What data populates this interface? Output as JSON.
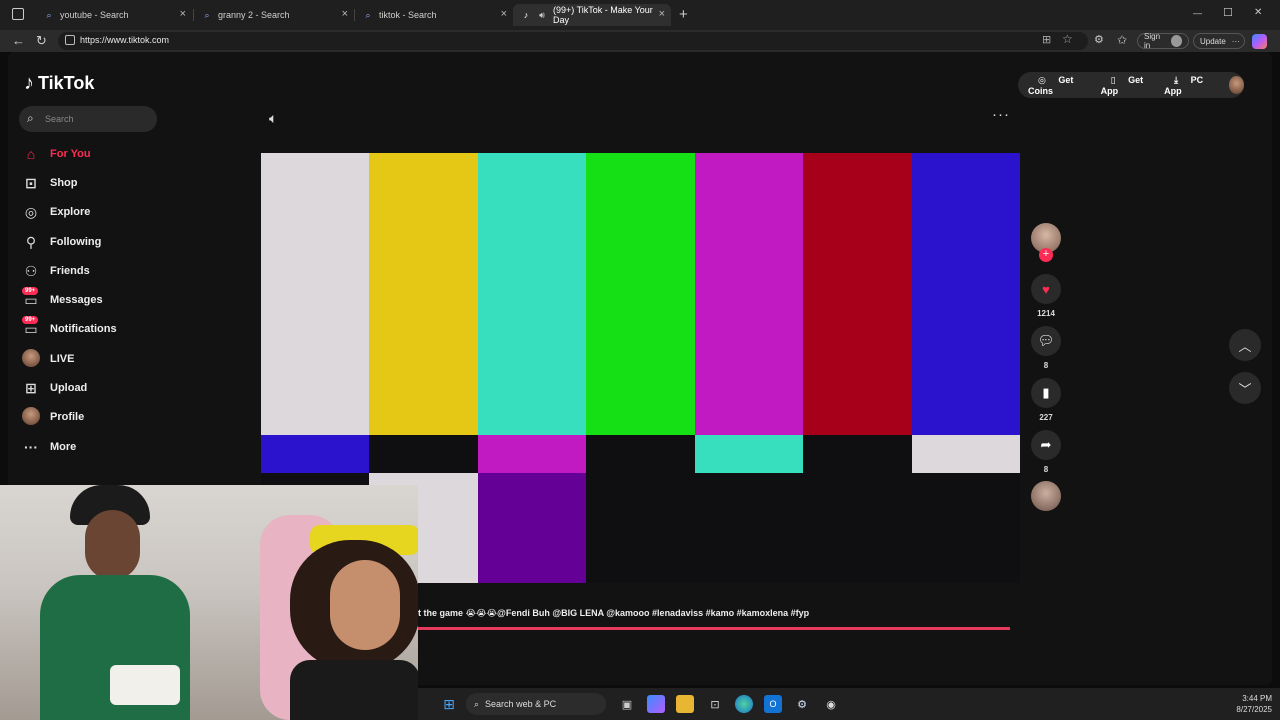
{
  "browser": {
    "tabs": [
      {
        "title": "youtube - Search",
        "active": false
      },
      {
        "title": "granny 2 - Search",
        "active": false
      },
      {
        "title": "tiktok - Search",
        "active": false
      },
      {
        "title": "(99+) TikTok - Make Your Day",
        "active": true
      }
    ],
    "new_tab": "+",
    "url": "https://www.tiktok.com",
    "sign_in": "Sign in",
    "update": "Update",
    "window_controls": {
      "minimize": "—",
      "maximize": "☐",
      "close": "✕"
    }
  },
  "sidebar": {
    "logo": "TikTok",
    "search_placeholder": "Search",
    "items": [
      {
        "label": "For You",
        "icon": "home-icon",
        "glyph": "⌂"
      },
      {
        "label": "Shop",
        "icon": "shop-icon",
        "glyph": "🛍"
      },
      {
        "label": "Explore",
        "icon": "compass-icon",
        "glyph": "◎"
      },
      {
        "label": "Following",
        "icon": "following-icon",
        "glyph": "⚲"
      },
      {
        "label": "Friends",
        "icon": "friends-icon",
        "glyph": "⚇"
      },
      {
        "label": "Messages",
        "icon": "messages-icon",
        "glyph": "▭",
        "badge": "99+"
      },
      {
        "label": "Notifications",
        "icon": "notifications-icon",
        "glyph": "▭",
        "badge": "99+"
      },
      {
        "label": "LIVE",
        "icon": "live-icon",
        "glyph": ""
      },
      {
        "label": "Upload",
        "icon": "upload-icon",
        "glyph": "⊞"
      },
      {
        "label": "Profile",
        "icon": "profile-icon",
        "glyph": ""
      },
      {
        "label": "More",
        "icon": "more-icon",
        "glyph": "···"
      }
    ]
  },
  "header": {
    "get_coins": "Get Coins",
    "get_app": "Get App",
    "pc_app": "PC App"
  },
  "video": {
    "caption": "t the game 😭😭😭@Fendi Buh  @BIG LENA  @kamooo  #lenadaviss  #kamo  #kamoxlena  #fyp",
    "progress": 0.99,
    "top_bars": [
      "#dcd8dc",
      "#e5c816",
      "#38dfbe",
      "#15e016",
      "#c21ac3",
      "#a6001a",
      "#2b12cc"
    ],
    "mid_bars": [
      "#2b12cc",
      "#0f0e10",
      "#c21ac3",
      "#0f0e10",
      "#38dfbe",
      "#0f0e10",
      "#dcd8dc"
    ],
    "bottom_bars": [
      "#0f0e10",
      "#dcd8dc",
      "#650096",
      "#0f0e10",
      "#0f0e10",
      "#0f0e10",
      "#0f0e10"
    ]
  },
  "actions": {
    "likes": "1214",
    "comments": "8",
    "saves": "227",
    "shares": "8"
  },
  "taskbar": {
    "search": "Search web & PC",
    "time": "3:44 PM",
    "date": "8/27/2025"
  }
}
